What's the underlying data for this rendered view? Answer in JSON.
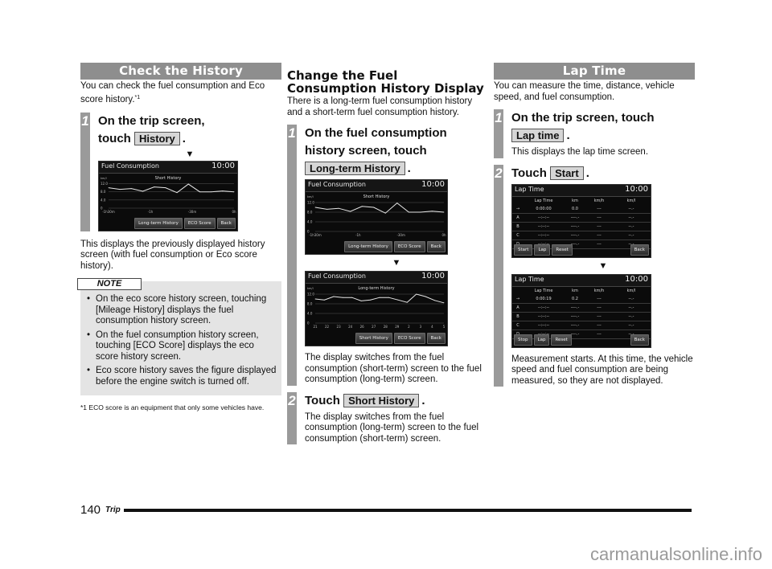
{
  "col1": {
    "banner": "Check the History",
    "intro": "You can check the fuel consumption and Eco score history.",
    "intro_footnote_ref": "*1",
    "step1": {
      "num": "1",
      "title_a": "On the trip screen,",
      "title_b": "touch",
      "button": "History",
      "punct": "."
    },
    "arrow": "▼",
    "screen": {
      "title": "Fuel Consumption",
      "clock": "10:00",
      "chart_title": "Short History",
      "unit": "km/l",
      "y_ticks": [
        "12.0",
        "8.0",
        "4.0",
        "0"
      ],
      "x_ticks": [
        "-1h30m",
        "-1h",
        "-30m",
        "0h"
      ],
      "buttons": [
        "Long-term History",
        "ECO Score",
        "Back"
      ]
    },
    "after": "This displays the previously displayed history screen (with fuel consumption or Eco score history).",
    "note": {
      "tag": "NOTE",
      "items": [
        "On the eco score history screen, touching [Mileage History] displays the fuel consumption history screen.",
        "On the fuel consumption history screen, touching [ECO Score] displays the eco score history screen.",
        "Eco score history saves the figure displayed before the engine switch is turned off."
      ]
    },
    "footnote": "*1  ECO score is an equipment that only some vehicles have."
  },
  "col2": {
    "heading": "Change the Fuel Consumption History Display",
    "intro": "There is a long-term fuel consumption history and a short-term fuel consumption history.",
    "step1": {
      "num": "1",
      "title_a": "On the fuel consumption",
      "title_b": "history screen, touch",
      "button": "Long-term History",
      "punct": "."
    },
    "screen_a": {
      "title": "Fuel Consumption",
      "clock": "10:00",
      "chart_title": "Short History",
      "unit": "km/l",
      "y_ticks": [
        "12.0",
        "8.0",
        "4.0",
        "0"
      ],
      "x_ticks": [
        "-1h30m",
        "-1h",
        "-30m",
        "0h"
      ],
      "buttons": [
        "Long-term History",
        "ECO Score",
        "Back"
      ]
    },
    "arrow": "▼",
    "screen_b": {
      "title": "Fuel Consumption",
      "clock": "10:00",
      "chart_title": "Long-term History",
      "unit": "km/l",
      "y_ticks": [
        "12.0",
        "8.0",
        "4.0",
        "0"
      ],
      "x_ticks": [
        "21",
        "22",
        "23",
        "24",
        "26",
        "27",
        "28",
        "29",
        "2",
        "3",
        "4",
        "5"
      ],
      "buttons": [
        "Short History",
        "ECO Score",
        "Back"
      ]
    },
    "step1_text": "The display switches from the fuel consumption (short-term) screen to the fuel consumption (long-term) screen.",
    "step2": {
      "num": "2",
      "title": "Touch",
      "button": "Short History",
      "punct": "."
    },
    "step2_text": "The display switches from the fuel consumption (long-term) screen to the fuel consumption (short-term) screen."
  },
  "col3": {
    "banner": "Lap Time",
    "intro": "You can measure the time, distance, vehicle speed, and fuel consumption.",
    "step1": {
      "num": "1",
      "title": "On the trip screen, touch",
      "button": "Lap time",
      "punct": "."
    },
    "step1_text": "This displays the lap time screen.",
    "step2": {
      "num": "2",
      "title": "Touch",
      "button": "Start",
      "punct": "."
    },
    "screen_a": {
      "title": "Lap Time",
      "clock": "10:00",
      "headers": [
        "",
        "Lap Time",
        "km",
        "km/h",
        "km/l"
      ],
      "rows": [
        [
          "→",
          "0:00:00",
          "0.0",
          "---",
          "--.-"
        ],
        [
          "A",
          "--:--:--",
          "----.-",
          "---",
          "--.-"
        ],
        [
          "B",
          "--:--:--",
          "----.-",
          "---",
          "--.-"
        ],
        [
          "C",
          "--:--:--",
          "----.-",
          "---",
          "--.-"
        ],
        [
          "D",
          "--:--:--",
          "----.-",
          "---",
          "--.-"
        ]
      ],
      "buttons_left": [
        "Start",
        "Lap",
        "Reset"
      ],
      "button_right": "Back"
    },
    "arrow": "▼",
    "screen_b": {
      "title": "Lap Time",
      "clock": "10:00",
      "headers": [
        "",
        "Lap Time",
        "km",
        "km/h",
        "km/l"
      ],
      "rows": [
        [
          "→",
          "0:00:19",
          "0.2",
          "---",
          "--.-"
        ],
        [
          "A",
          "--:--:--",
          "----.-",
          "---",
          "--.-"
        ],
        [
          "B",
          "--:--:--",
          "----.-",
          "---",
          "--.-"
        ],
        [
          "C",
          "--:--:--",
          "----.-",
          "---",
          "--.-"
        ],
        [
          "D",
          "--:--:--",
          "----.-",
          "---",
          "--.-"
        ]
      ],
      "buttons_left": [
        "Stop",
        "Lap",
        "Reset"
      ],
      "button_right": "Back"
    },
    "step2_text": "Measurement starts. At this time, the vehicle speed and fuel consumption are being measured, so they are not displayed."
  },
  "footer": {
    "page": "140",
    "section": "Trip"
  },
  "watermark": "carmanualsonline.info",
  "charts": {
    "short": [
      10.0,
      9.2,
      9.6,
      8.3,
      10.4,
      10.0,
      7.6,
      11.8,
      8.0,
      8.0,
      8.4,
      8.0
    ],
    "long": [
      10.0,
      9.6,
      11.0,
      10.6,
      10.6,
      9.2,
      9.6,
      10.6,
      10.6,
      9.6,
      8.6,
      12.0,
      11.0,
      9.4,
      8.4
    ]
  }
}
